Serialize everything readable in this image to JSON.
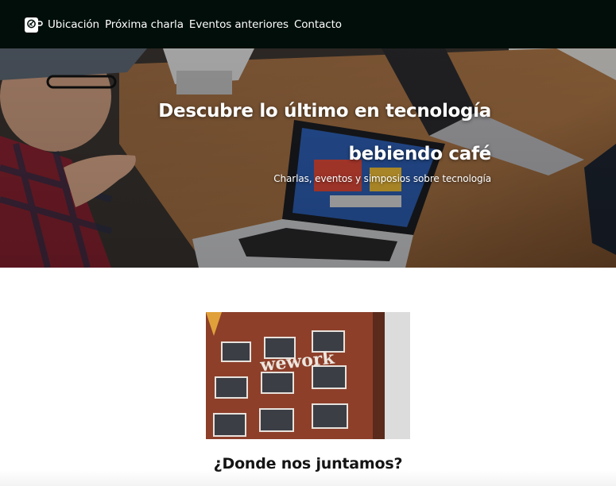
{
  "nav": {
    "logo_icon": "coffee-cup-icon",
    "items": [
      {
        "label": "Ubicación"
      },
      {
        "label": "Próxima charla"
      },
      {
        "label": "Eventos anteriores"
      },
      {
        "label": "Contacto"
      }
    ]
  },
  "hero": {
    "title": "Descubre lo último en tecnología bebiendo café",
    "subtitle": "Charlas, eventos y simposios sobre tecnología"
  },
  "venue": {
    "photo_sign": "wework",
    "heading": "¿Donde nos juntamos?"
  },
  "colors": {
    "nav_background": "#010e09",
    "text_light": "#ffffff",
    "heading_dark": "#141414"
  }
}
